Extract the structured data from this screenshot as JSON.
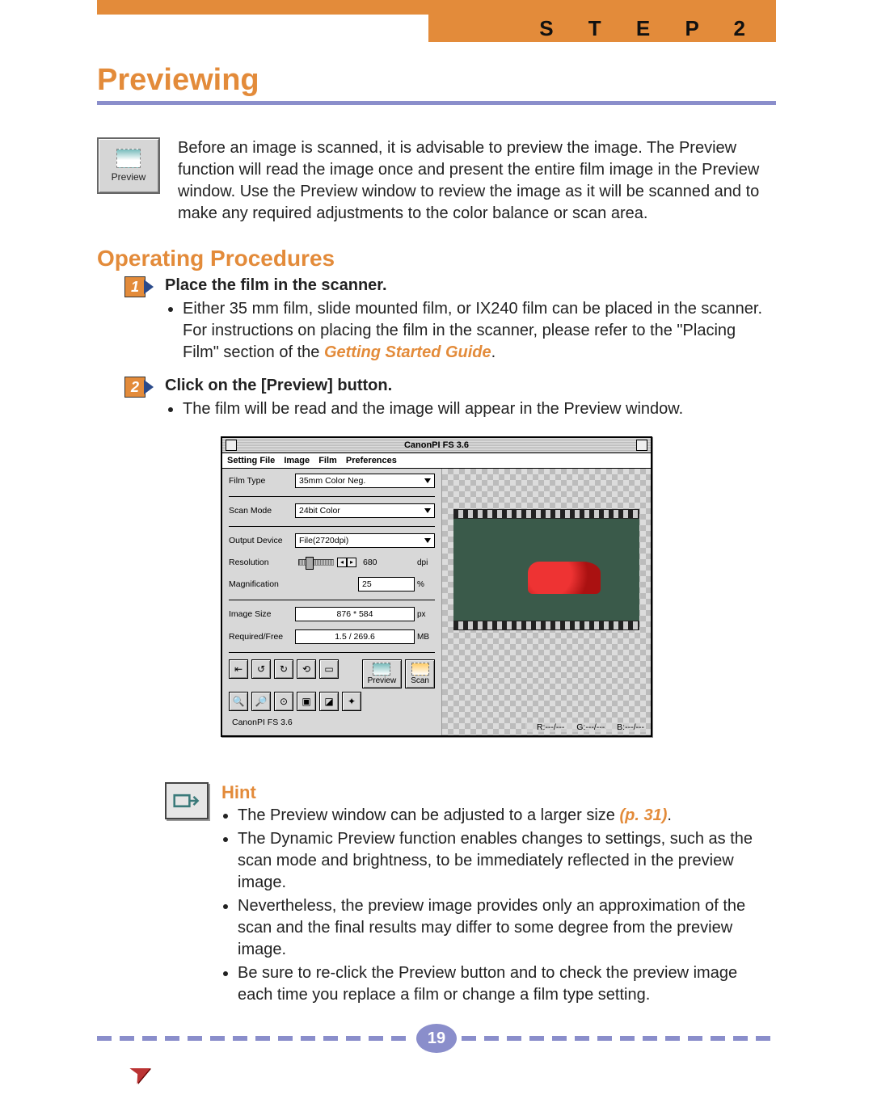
{
  "step_banner": "S T E P     2",
  "title": "Previewing",
  "preview_button_icon_label": "Preview",
  "intro": "Before an image is scanned, it is advisable to preview the image. The Preview function will read the image once and present the entire film image in the Preview window. Use the Preview window to review the image as it will be scanned and to make any required adjustments to the color balance or scan area.",
  "section_heading": "Operating Procedures",
  "steps": [
    {
      "num": "1",
      "head": "Place the film in the scanner.",
      "bullets": [
        "Either 35 mm film, slide mounted film, or IX240 film can be placed in the scanner. For instructions on placing the film in the scanner, please refer to the \"Placing Film\" section of the "
      ],
      "bullets_em": "Getting Started Guide",
      "bullets_tail": "."
    },
    {
      "num": "2",
      "head": "Click on the [Preview] button.",
      "bullets": [
        "The film will be read and the image will appear in the Preview window."
      ]
    }
  ],
  "screenshot": {
    "window_title": "CanonPI FS 3.6",
    "menus": [
      "Setting File",
      "Image",
      "Film",
      "Preferences"
    ],
    "fields": {
      "film_type_label": "Film Type",
      "film_type_value": "35mm Color Neg.",
      "scan_mode_label": "Scan Mode",
      "scan_mode_value": "24bit Color",
      "output_device_label": "Output Device",
      "output_device_value": "File(2720dpi)",
      "resolution_label": "Resolution",
      "resolution_value": "680",
      "resolution_unit": "dpi",
      "magnification_label": "Magnification",
      "magnification_value": "25",
      "magnification_unit": "%",
      "image_size_label": "Image Size",
      "image_size_value": "876 * 584",
      "image_size_unit": "px",
      "required_free_label": "Required/Free",
      "required_free_value": "1.5 / 269.6",
      "required_free_unit": "MB"
    },
    "buttons": {
      "preview": "Preview",
      "scan": "Scan"
    },
    "status_left": "CanonPI FS 3.6",
    "rgb_r": "R:---/---",
    "rgb_g": "G:---/---",
    "rgb_b": "B:---/---"
  },
  "hint": {
    "title": "Hint",
    "bullets": [
      {
        "text_pre": "The Preview window can be adjusted to a larger size ",
        "ref": "(p. 31)",
        "text_post": "."
      },
      {
        "text_pre": "The Dynamic Preview function enables changes to settings, such as the scan mode and brightness, to be immediately reflected in the preview image."
      },
      {
        "text_pre": "Nevertheless, the preview image provides only an approximation of the scan and the final results may differ to some degree from the preview image."
      },
      {
        "text_pre": "Be sure to re-click the Preview button and to check the preview image each time you replace a film or change a film type setting."
      }
    ]
  },
  "page_number": "19"
}
